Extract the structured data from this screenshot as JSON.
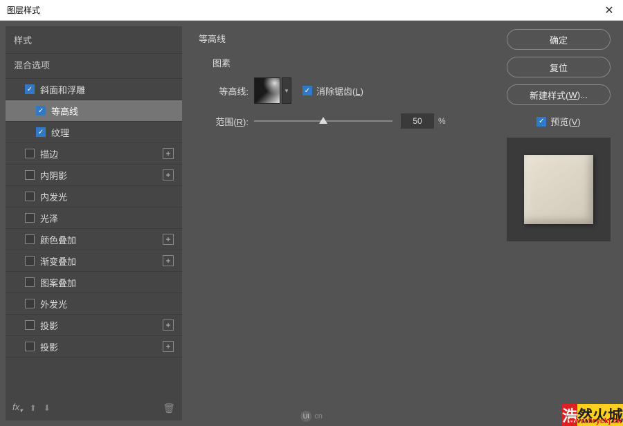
{
  "titlebar": {
    "title": "图层样式"
  },
  "left": {
    "header": "样式",
    "subheader": "混合选项",
    "items": [
      {
        "id": "bevel",
        "label": "斜面和浮雕",
        "checked": true,
        "indent": 1,
        "plus": false
      },
      {
        "id": "contour",
        "label": "等高线",
        "checked": true,
        "indent": 2,
        "plus": false,
        "selected": true
      },
      {
        "id": "texture",
        "label": "纹理",
        "checked": true,
        "indent": 2,
        "plus": false
      },
      {
        "id": "stroke",
        "label": "描边",
        "checked": false,
        "indent": 1,
        "plus": true
      },
      {
        "id": "inner-shadow",
        "label": "内阴影",
        "checked": false,
        "indent": 1,
        "plus": true
      },
      {
        "id": "inner-glow",
        "label": "内发光",
        "checked": false,
        "indent": 1,
        "plus": false
      },
      {
        "id": "satin",
        "label": "光泽",
        "checked": false,
        "indent": 1,
        "plus": false
      },
      {
        "id": "color-overlay",
        "label": "颜色叠加",
        "checked": false,
        "indent": 1,
        "plus": true
      },
      {
        "id": "gradient-overlay",
        "label": "渐变叠加",
        "checked": false,
        "indent": 1,
        "plus": true
      },
      {
        "id": "pattern-overlay",
        "label": "图案叠加",
        "checked": false,
        "indent": 1,
        "plus": false
      },
      {
        "id": "outer-glow",
        "label": "外发光",
        "checked": false,
        "indent": 1,
        "plus": false
      },
      {
        "id": "drop-shadow-1",
        "label": "投影",
        "checked": false,
        "indent": 1,
        "plus": true
      },
      {
        "id": "drop-shadow-2",
        "label": "投影",
        "checked": false,
        "indent": 1,
        "plus": true
      }
    ],
    "footer": {
      "fx": "fx"
    }
  },
  "center": {
    "title": "等高线",
    "section": "图素",
    "contour_label": "等高线:",
    "antialiased_label": "消除锯齿(L)",
    "antialiased_underline": "L",
    "range_label": "范围(R):",
    "range_underline": "R",
    "range_value": "50",
    "range_unit": "%"
  },
  "right": {
    "ok": "确定",
    "reset": "复位",
    "new_style": "新建样式(W)...",
    "preview": "预览(V)"
  },
  "watermark": {
    "red": "浩",
    "yellow": "然火城",
    "url": "www.hryckj.cn"
  },
  "badge": {
    "text": "cn",
    "icon": "UI"
  }
}
